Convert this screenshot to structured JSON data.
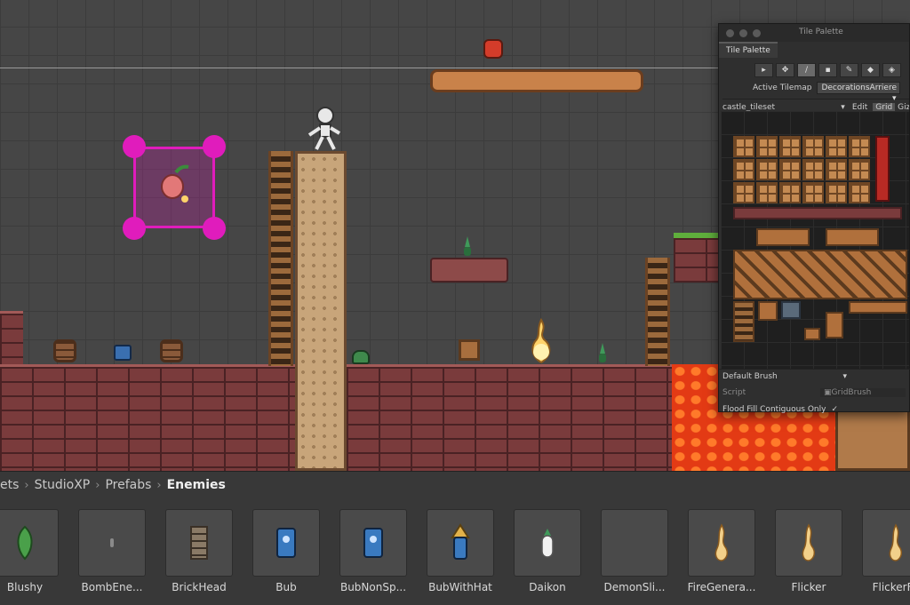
{
  "tile_palette": {
    "window_title": "Tile Palette",
    "tab": "Tile Palette",
    "tools": [
      "select-icon",
      "move-icon",
      "paint-brush-icon",
      "box-fill-icon",
      "picker-icon",
      "eraser-icon",
      "fill-icon"
    ],
    "active_tilemap_label": "Active Tilemap",
    "active_tilemap_value": "DecorationsArriere",
    "palette_name": "castle_tileset",
    "edit_label": "Edit",
    "grid_label": "Grid",
    "gizmos_label": "Gizmos",
    "brush": "Default Brush",
    "script_label": "Script",
    "script_value": "GridBrush",
    "flood_fill_label": "Flood Fill Contiguous Only",
    "flood_fill_checked": "✓"
  },
  "project": {
    "breadcrumb": [
      "ets",
      "StudioXP",
      "Prefabs",
      "Enemies"
    ],
    "assets": [
      {
        "name": "Blushy",
        "icon": "green-leaf-icon"
      },
      {
        "name": "BombEne...",
        "icon": "small-gray-icon"
      },
      {
        "name": "BrickHead",
        "icon": "brick-icon"
      },
      {
        "name": "Bub",
        "icon": "blue-card-icon"
      },
      {
        "name": "BubNonSp...",
        "icon": "blue-card-icon"
      },
      {
        "name": "BubWithHat",
        "icon": "hat-icon"
      },
      {
        "name": "Daikon",
        "icon": "radish-icon"
      },
      {
        "name": "DemonSli...",
        "icon": "empty-icon"
      },
      {
        "name": "FireGenera...",
        "icon": "flame-icon"
      },
      {
        "name": "Flicker",
        "icon": "flame-icon"
      },
      {
        "name": "FlickerFo",
        "icon": "flame-icon"
      }
    ]
  },
  "colors": {
    "selection": "#e01cbc",
    "lava": "#e33a14",
    "brick": "#7a3b3c"
  }
}
